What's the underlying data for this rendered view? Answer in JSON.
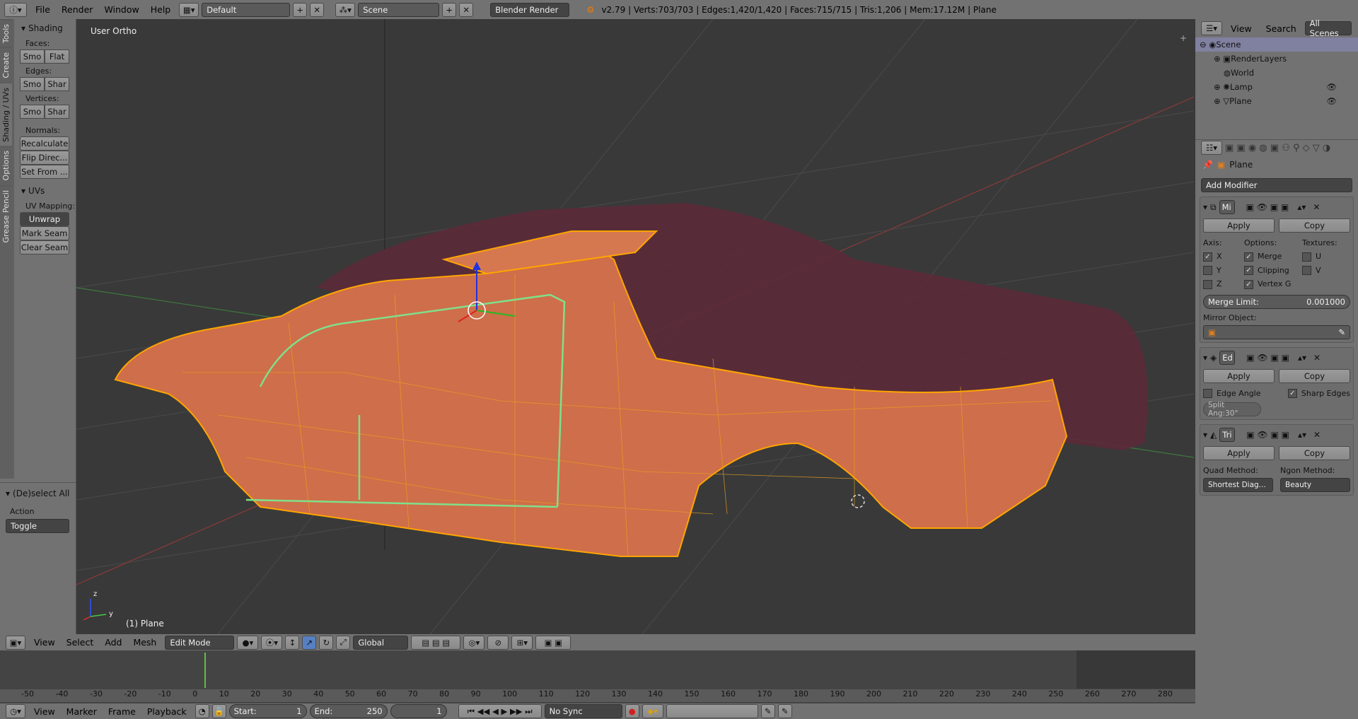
{
  "topbar": {
    "menus": [
      "File",
      "Render",
      "Window",
      "Help"
    ],
    "layout": "Default",
    "scene": "Scene",
    "engine": "Blender Render",
    "stats": "v2.79 | Verts:703/703 | Edges:1,420/1,420 | Faces:715/715 | Tris:1,206 | Mem:17.12M | Plane"
  },
  "toolshelf": {
    "tabs": [
      "Tools",
      "Create",
      "Shading / UVs",
      "Options",
      "Grease Pencil"
    ],
    "shading": {
      "title": "Shading",
      "faces_label": "Faces:",
      "edges_label": "Edges:",
      "vertices_label": "Vertices:",
      "smooth": "Smo",
      "flat": "Flat",
      "sharp": "Shar",
      "normals_label": "Normals:",
      "recalculate": "Recalculate",
      "flip": "Flip Direc...",
      "set_from": "Set From ..."
    },
    "uvs": {
      "title": "UVs",
      "mapping_label": "UV Mapping:",
      "unwrap": "Unwrap",
      "mark_seam": "Mark Seam",
      "clear_seam": "Clear Seam"
    },
    "operator": {
      "title": "(De)select All",
      "action_label": "Action",
      "action_value": "Toggle"
    }
  },
  "viewport": {
    "view_name": "User Ortho",
    "object_label": "(1) Plane",
    "axis_z": "z",
    "axis_y": "y"
  },
  "viewport_header": {
    "menus": [
      "View",
      "Select",
      "Add",
      "Mesh"
    ],
    "mode": "Edit Mode",
    "orientation": "Global"
  },
  "outliner": {
    "menus": [
      "View",
      "Search"
    ],
    "filter": "All Scenes",
    "items": [
      "Scene",
      "RenderLayers",
      "World",
      "Lamp",
      "Plane"
    ]
  },
  "properties": {
    "object_name": "Plane",
    "add_modifier": "Add Modifier",
    "mirror": {
      "name": "Mi",
      "apply": "Apply",
      "copy": "Copy",
      "axis_label": "Axis:",
      "options_label": "Options:",
      "textures_label": "Textures:",
      "x": "X",
      "y": "Y",
      "z": "Z",
      "merge": "Merge",
      "clipping": "Clipping",
      "vertex_g": "Vertex G",
      "u": "U",
      "v": "V",
      "merge_limit_label": "Merge Limit:",
      "merge_limit_value": "0.001000",
      "mirror_object_label": "Mirror Object:"
    },
    "edgesplit": {
      "name": "Ed",
      "apply": "Apply",
      "copy": "Copy",
      "edge_angle": "Edge Angle",
      "sharp_edges": "Sharp Edges",
      "split_angle": "Split Ang:30°"
    },
    "triangulate": {
      "name": "Tri",
      "apply": "Apply",
      "copy": "Copy",
      "quad_label": "Quad Method:",
      "ngon_label": "Ngon Method:",
      "quad_value": "Shortest Diag...",
      "ngon_value": "Beauty"
    }
  },
  "timeline": {
    "ticks": [
      "-50",
      "-40",
      "-30",
      "-20",
      "-10",
      "0",
      "10",
      "20",
      "30",
      "40",
      "50",
      "60",
      "70",
      "80",
      "90",
      "100",
      "110",
      "120",
      "130",
      "140",
      "150",
      "160",
      "170",
      "180",
      "190",
      "200",
      "210",
      "220",
      "230",
      "240",
      "250",
      "260",
      "270",
      "280"
    ],
    "menus": [
      "View",
      "Marker",
      "Frame",
      "Playback"
    ],
    "start": "Start:",
    "start_value": "1",
    "end": "End:",
    "end_value": "250",
    "current": "1",
    "sync": "No Sync"
  }
}
